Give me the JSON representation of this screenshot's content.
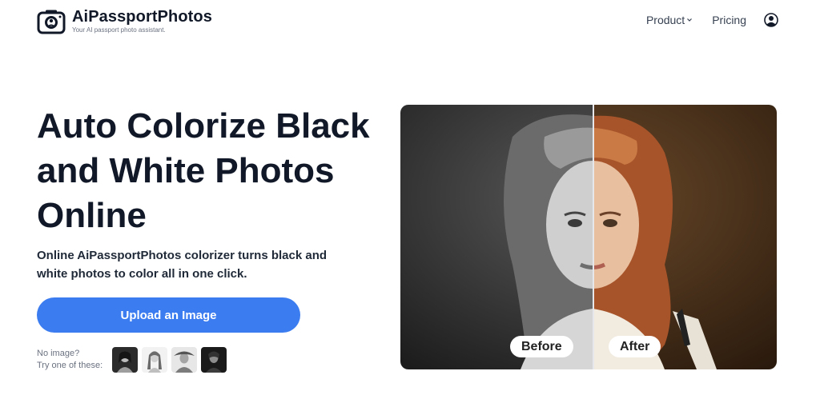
{
  "brand": {
    "name": "AiPassportPhotos",
    "tagline": "Your AI passport photo assistant."
  },
  "nav": {
    "product": "Product",
    "pricing": "Pricing",
    "account_icon": "user-circle-icon"
  },
  "hero": {
    "title": "Auto Colorize Black and White Photos Online",
    "description": "Online AiPassportPhotos colorizer turns black and white photos to color all in one click.",
    "upload_label": "Upload an Image",
    "samples_line1": "No image?",
    "samples_line2": "Try one of these:"
  },
  "compare": {
    "before_label": "Before",
    "after_label": "After"
  },
  "colors": {
    "accent": "#3b7cf0",
    "text": "#111827"
  }
}
